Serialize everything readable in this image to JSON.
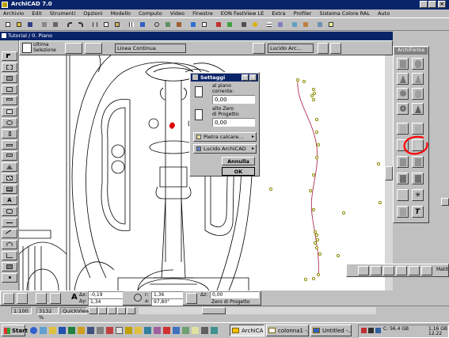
{
  "app": {
    "title": "ArchiCAD 7.0"
  },
  "menu": [
    "Archivio",
    "Edit",
    "Strumenti",
    "Opzioni",
    "Modello",
    "Computo",
    "Video",
    "Finestre",
    "EON FastView LE",
    "Extra",
    "Profiler",
    "Sistema Colore RAL",
    "Auto"
  ],
  "drawing_window": {
    "title": "Tutorial / 0. Piano"
  },
  "info_box": {
    "selection_label": "Ultima\nSelezione",
    "line_type": "Linea Continua",
    "layer": "Lucido Arc..."
  },
  "settings_dialog": {
    "title": "Settaggi",
    "floor_label": "al piano\ncorrente:",
    "floor_value": "0,00",
    "zero_label": "alto Zero\ndi Progetto:",
    "zero_value": "0,00",
    "material": "Pietra calcare...",
    "layer": "Lucido ArchiCAD",
    "cancel_button": "Annulla",
    "ok_button": "OK"
  },
  "archiforma": {
    "title": "ArchiForma"
  },
  "mini_toolbar": {
    "label": "Matit"
  },
  "coordinates": {
    "ax_label": "Δx:",
    "ax_value": "-0,19",
    "ay_label": "Δy:",
    "ay_value": "1,34",
    "r_label": "r:",
    "r_value": "1,36",
    "a_label": "a:",
    "a_value": "97,80°",
    "z_label": "Δz:",
    "z_value": "0,00",
    "zero_ref": "Zero di Progetto"
  },
  "status_bar": {
    "scale": "1:100",
    "zoom": "3132 %",
    "view": "QuickView"
  },
  "taskbar": {
    "start": "Start",
    "items": [
      "ArchiCAD...",
      "colonna1 -...",
      "Untitled -..."
    ],
    "disk": "C: 56.4 GB",
    "memory": "1.16 GB",
    "clock": "12.22"
  },
  "colors": {
    "title_bar": "#0a246a",
    "drawing_bg": "#ffffff",
    "profile_line": "#b03050",
    "profile_points": "#8a8a00",
    "annotation": "#ff0000",
    "marker": "#e00000"
  }
}
